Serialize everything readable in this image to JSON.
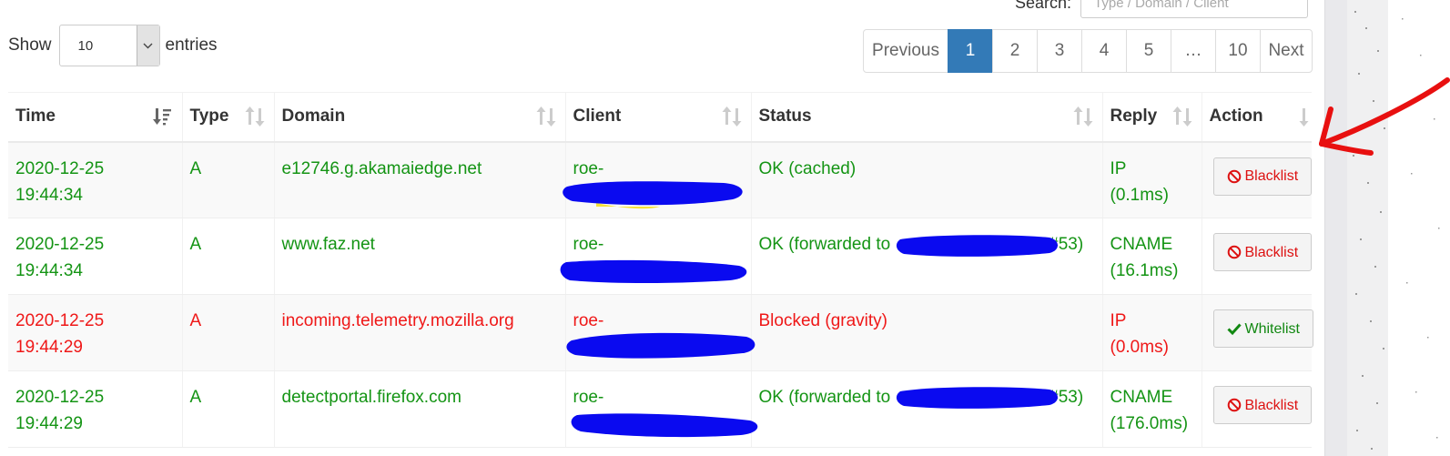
{
  "search": {
    "label": "Search:",
    "placeholder": "Type / Domain / Client"
  },
  "length": {
    "show_label": "Show",
    "value": "10",
    "entries_label": "entries"
  },
  "pagination": {
    "previous": "Previous",
    "pages": [
      "1",
      "2",
      "3",
      "4",
      "5",
      "…",
      "10"
    ],
    "next": "Next",
    "active": "1"
  },
  "columns": [
    "Time",
    "Type",
    "Domain",
    "Client",
    "Status",
    "Reply",
    "Action"
  ],
  "rows": [
    {
      "time": "2020-12-25 19:44:34",
      "type": "A",
      "domain": "e12746.g.akamaiedge.net",
      "client": "roe-",
      "status": "OK (cached)",
      "reply_type": "IP",
      "reply_time": "(0.1ms)",
      "action": "Blacklist",
      "state": "ok"
    },
    {
      "time": "2020-12-25 19:44:34",
      "type": "A",
      "domain": "www.faz.net",
      "client": "roe-",
      "status": "OK (forwarded to",
      "status_suffix": "#53)",
      "reply_type": "CNAME",
      "reply_time": "(16.1ms)",
      "action": "Blacklist",
      "state": "ok"
    },
    {
      "time": "2020-12-25 19:44:29",
      "type": "A",
      "domain": "incoming.telemetry.mozilla.org",
      "client": "roe-",
      "status": "Blocked (gravity)",
      "reply_type": "IP",
      "reply_time": "(0.0ms)",
      "action": "Whitelist",
      "state": "blocked"
    },
    {
      "time": "2020-12-25 19:44:29",
      "type": "A",
      "domain": "detectportal.firefox.com",
      "client": "roe-",
      "status": "OK (forwarded to",
      "status_suffix": "#53)",
      "reply_type": "CNAME",
      "reply_time": "(176.0ms)",
      "action": "Blacklist",
      "state": "ok"
    }
  ],
  "colors": {
    "ok": "#149414",
    "blocked": "#ef1818",
    "accent": "#337ab7",
    "annotation": "#e81010",
    "redaction": "#0a0af0"
  }
}
